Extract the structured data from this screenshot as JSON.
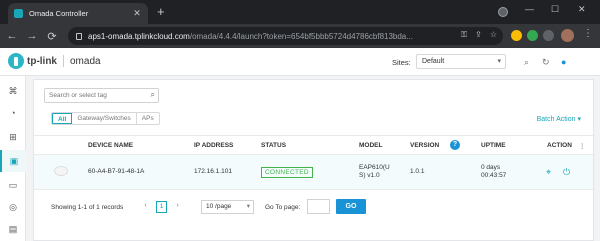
{
  "browser": {
    "tab_title": "Omada Controller",
    "tab_close": "✕",
    "new_tab": "+",
    "minimize": "—",
    "maximize": "☐",
    "close": "✕",
    "url_host": "aps1-omada.tplinkcloud.com",
    "url_rest": "/omada/4.4.4/launch?token=654bf5bbb5724d4786cbf813bda...",
    "back": "←",
    "forward": "→",
    "reload": "⟳",
    "home": "⌂",
    "key_icon": "⚿",
    "share_icon": "⇪",
    "star_icon": "☆",
    "menu": "⋮",
    "extension_colors": [
      "#fbbc04",
      "#34a853",
      "#5f6368"
    ]
  },
  "header": {
    "logo_text": "tp-link",
    "product": "omada",
    "sites_label": "Sites:",
    "sites_value": "Default",
    "icons": [
      "search-icon",
      "refresh-icon",
      "user-icon"
    ]
  },
  "sidebar": {
    "items": [
      "dashboard-icon",
      "statistics-icon",
      "map-icon",
      "devices-icon",
      "clients-icon",
      "insight-icon",
      "log-icon"
    ],
    "active_index": 3
  },
  "panel": {
    "search_placeholder": "Search or select tag",
    "filter_tabs": [
      "All",
      "Gateway/Switches",
      "APs"
    ],
    "active_tab": "All",
    "batch_action": "Batch Action",
    "columns": {
      "device_name": "DEVICE NAME",
      "ip": "IP ADDRESS",
      "status": "STATUS",
      "model": "MODEL",
      "version": "VERSION",
      "uptime": "UPTIME",
      "action": "ACTION"
    },
    "rows": [
      {
        "device_name": "60-A4-B7-91-48-1A",
        "ip": "172.16.1.101",
        "status": "CONNECTED",
        "model_line1": "EAP610(U",
        "model_line2": "S) v1.0",
        "version": "1.0.1",
        "uptime_line1": "0 days",
        "uptime_line2": "00:43:57"
      }
    ],
    "footer": {
      "records": "Showing 1-1 of 1 records",
      "page": "1",
      "per_page": "10 /page",
      "goto_label": "Go To page:",
      "go_button": "GO"
    },
    "colors": {
      "accent": "#19a5b8",
      "connected": "#42b34d",
      "primary_button": "#1a93d6"
    }
  }
}
